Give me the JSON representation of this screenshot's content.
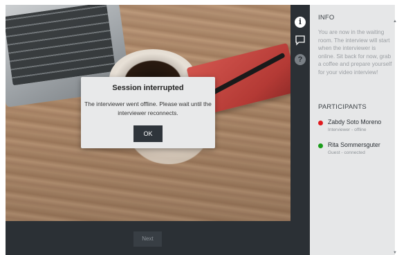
{
  "dialog": {
    "title": "Session interrupted",
    "message": "The interviewer went offline. Please wait until the interviewer reconnects.",
    "ok_label": "OK"
  },
  "footer": {
    "next_label": "Next"
  },
  "rail": {
    "icons": [
      "info-icon",
      "chat-icon",
      "help-icon"
    ],
    "info_glyph": "i",
    "help_glyph": "?"
  },
  "sidebar": {
    "info_title": "INFO",
    "info_text": "You are now in the waiting room. The interview will start when the interviewer is online. Sit back for now, grab a coffee and prepare yourself for your video interview!",
    "participants_title": "PARTICIPANTS",
    "participants": [
      {
        "name": "Zabdy Soto Moreno",
        "role": "Interviewer - offline",
        "status_color": "#e0191e"
      },
      {
        "name": "Rita Sommersguter",
        "role": "Guest - connected",
        "status_color": "#1a9c1a"
      }
    ]
  },
  "scrollbar": {
    "up_glyph": "▲",
    "down_glyph": "▼"
  },
  "colors": {
    "dark_chrome": "#2b3035",
    "sidebar_bg": "#e6e7e8",
    "dialog_bg": "#e8e9ea",
    "ok_button": "#2f353b"
  }
}
